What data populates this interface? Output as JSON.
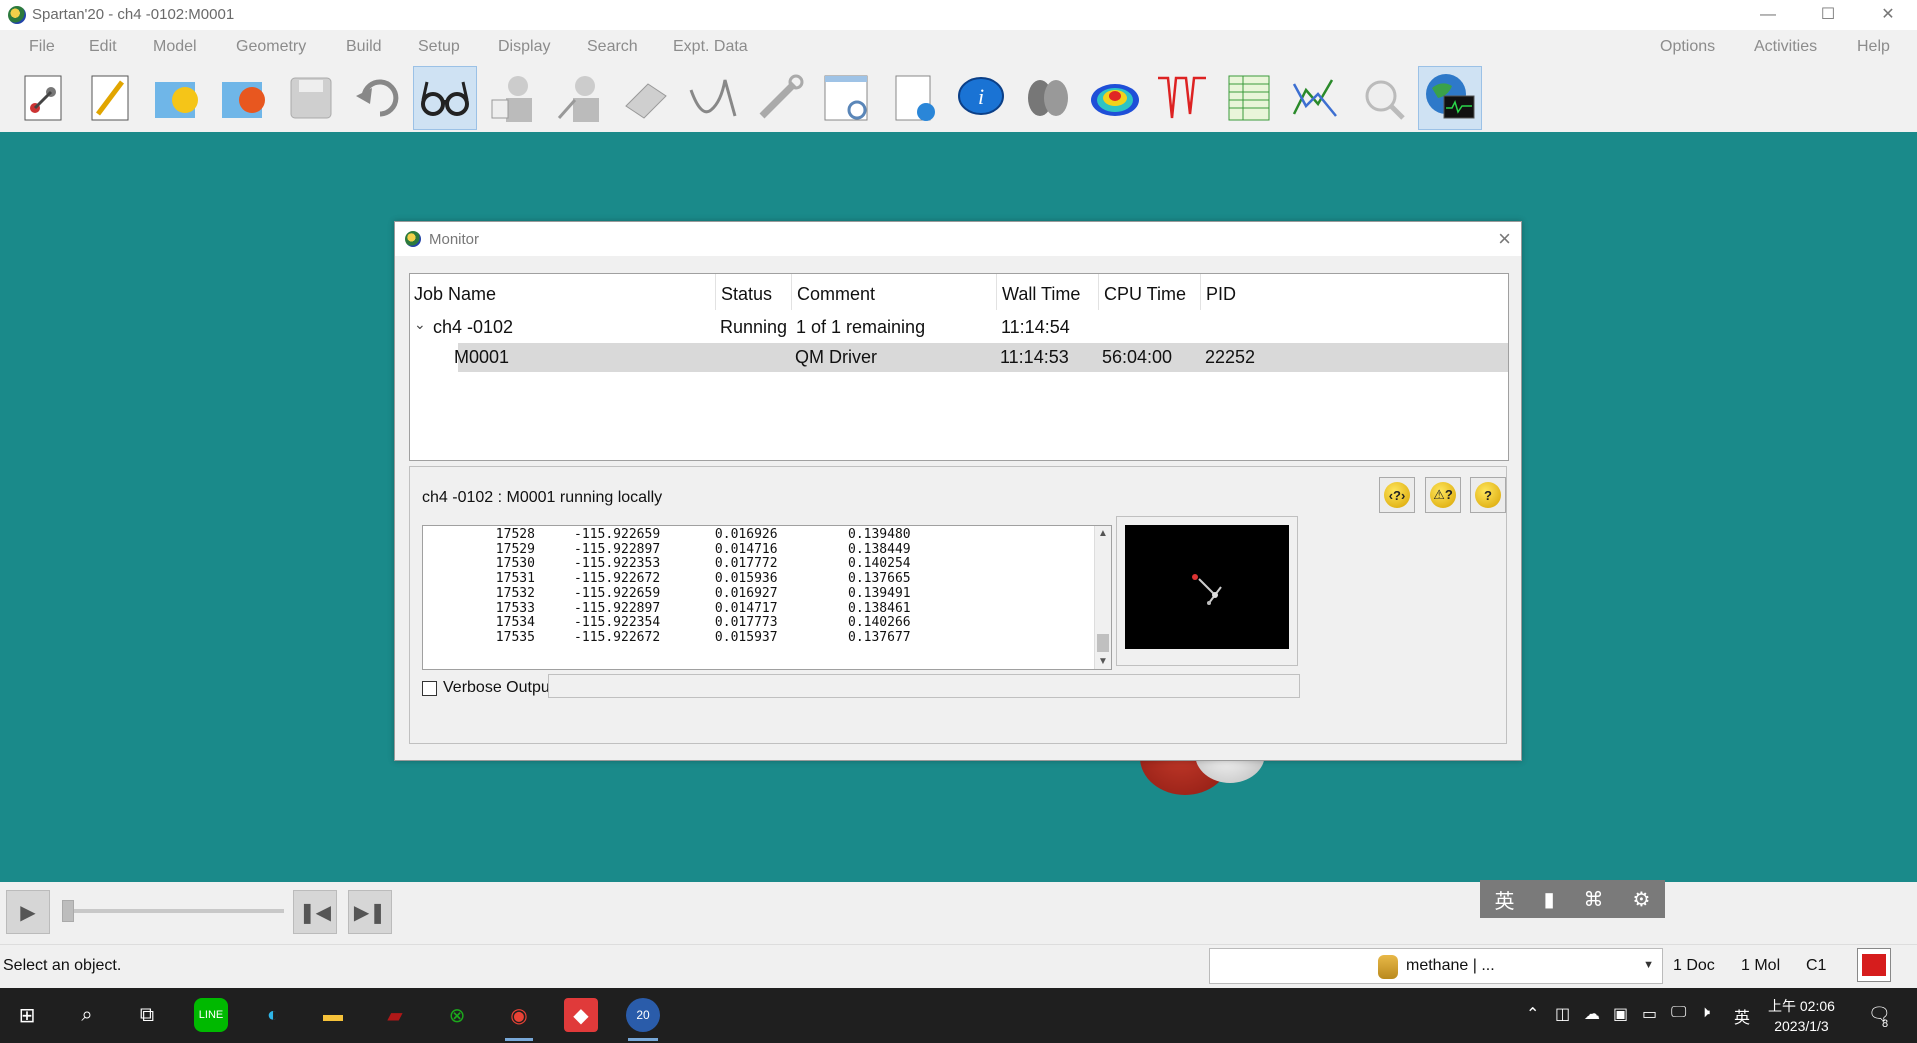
{
  "window": {
    "title": "Spartan'20 - ch4 -0102:M0001",
    "controls": [
      "—",
      "☐",
      "✕"
    ]
  },
  "menu": {
    "left": [
      "File",
      "Edit",
      "Model",
      "Geometry",
      "Build",
      "Setup",
      "Display",
      "Search",
      "Expt. Data"
    ],
    "right": [
      "Options",
      "Activities",
      "Help"
    ]
  },
  "toolbar": {
    "buttons": [
      "new-molecule",
      "new-sketch",
      "open-file",
      "open-recent",
      "save",
      "undo",
      "view",
      "build-molecule",
      "edit-molecule",
      "delete",
      "minimize-energy",
      "clear-geometry",
      "calculations",
      "properties",
      "info",
      "orbitals",
      "surfaces",
      "spectra",
      "spreadsheet",
      "plots",
      "measure-search",
      "monitor"
    ],
    "active": "view"
  },
  "monitor": {
    "title": "Monitor",
    "columns": [
      "Job Name",
      "Status",
      "Comment",
      "Wall Time",
      "CPU Time",
      "PID"
    ],
    "job": {
      "name": "ch4 -0102",
      "status": "Running",
      "comment": "1 of 1 remaining",
      "wall_time": "11:14:54",
      "cpu_time": "",
      "pid": ""
    },
    "subjob": {
      "name": "M0001",
      "status": "",
      "comment": "QM Driver",
      "wall_time": "11:14:53",
      "cpu_time": "56:04:00",
      "pid": "22252"
    },
    "status_line": "ch4 -0102 : M0001 running locally",
    "output_lines": [
      [
        "17528",
        "-115.922659",
        "0.016926",
        "0.139480"
      ],
      [
        "17529",
        "-115.922897",
        "0.014716",
        "0.138449"
      ],
      [
        "17530",
        "-115.922353",
        "0.017772",
        "0.140254"
      ],
      [
        "17531",
        "-115.922672",
        "0.015936",
        "0.137665"
      ],
      [
        "17532",
        "-115.922659",
        "0.016927",
        "0.139491"
      ],
      [
        "17533",
        "-115.922897",
        "0.014717",
        "0.138461"
      ],
      [
        "17534",
        "-115.922354",
        "0.017773",
        "0.140266"
      ],
      [
        "17535",
        "-115.922672",
        "0.015937",
        "0.137677"
      ]
    ],
    "verbose_label": "Verbose Output",
    "help_buttons": [
      "‹?›",
      "⚠?",
      "?"
    ]
  },
  "playback": {
    "ime": [
      "英",
      "▮",
      "⌘",
      "⚙"
    ]
  },
  "statusbar": {
    "message": "Select an object.",
    "molecule_select": "methane | ...",
    "docs": "1 Doc",
    "mols": "1 Mol",
    "symmetry": "C1"
  },
  "taskbar": {
    "ime_lang": "英",
    "clock_time": "上午 02:06",
    "clock_date": "2023/1/3",
    "notifications": "8"
  },
  "colors": {
    "workspace": "#1a8a8a",
    "titlebar": "#ffffff",
    "taskbar": "#1f1f1f"
  }
}
